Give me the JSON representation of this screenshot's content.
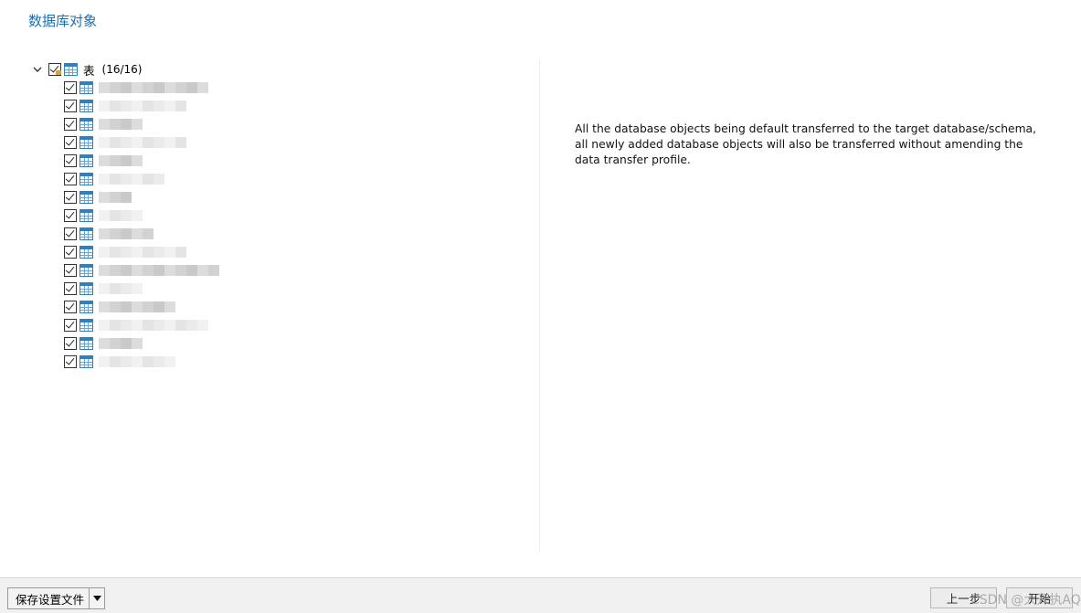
{
  "header": {
    "title": "数据库对象"
  },
  "tree": {
    "root": {
      "label": "表",
      "count": "(16/16)",
      "checked": true,
      "expanded": true
    },
    "items": [
      {
        "checked": true,
        "label_blurred": true
      },
      {
        "checked": true,
        "label_blurred": true
      },
      {
        "checked": true,
        "label_blurred": true
      },
      {
        "checked": true,
        "label_blurred": true
      },
      {
        "checked": true,
        "label_blurred": true
      },
      {
        "checked": true,
        "label_blurred": true
      },
      {
        "checked": true,
        "label_blurred": true
      },
      {
        "checked": true,
        "label_blurred": true
      },
      {
        "checked": true,
        "label_blurred": true
      },
      {
        "checked": true,
        "label_blurred": true
      },
      {
        "checked": true,
        "label_blurred": true
      },
      {
        "checked": true,
        "label_blurred": true
      },
      {
        "checked": true,
        "label_blurred": true
      },
      {
        "checked": true,
        "label_blurred": true
      },
      {
        "checked": true,
        "label_blurred": true
      },
      {
        "checked": true,
        "label_blurred": true
      }
    ]
  },
  "description": "All the database objects being default transferred to the target database/schema, all newly added database objects will also be transferred without amending the data transfer profile.",
  "footer": {
    "save_profile_label": "保存设置文件",
    "back_label": "上一步",
    "start_label": "开始",
    "watermark": "CSDN @大开执AQ"
  },
  "colors": {
    "title": "#1a6fb5",
    "table_icon": "#2f7fc1",
    "lock": "#e3a21a"
  }
}
